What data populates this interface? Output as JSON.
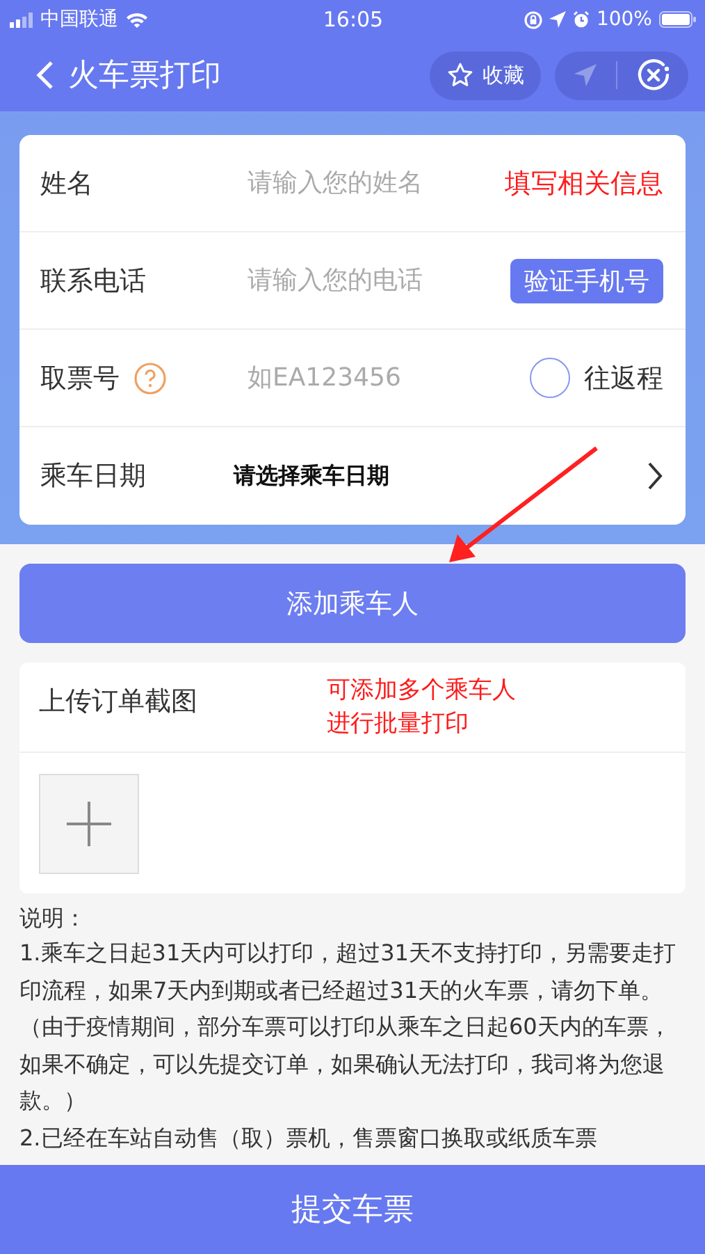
{
  "status_bar": {
    "carrier": "中国联通",
    "time": "16:05",
    "battery": "100%"
  },
  "nav": {
    "title": "火车票打印",
    "favorite": "收藏"
  },
  "form": {
    "fields": [
      {
        "kind": "text",
        "label": "姓名",
        "placeholder": "请输入您的姓名",
        "note": "填写相关信息"
      },
      {
        "kind": "phone",
        "label": "联系电话",
        "placeholder": "请输入您的电话",
        "button": "验证手机号"
      },
      {
        "kind": "ticket",
        "label": "取票号",
        "placeholder": "如EA123456",
        "option": {
          "label": "往返程",
          "checked": false
        }
      },
      {
        "kind": "date",
        "label": "乘车日期",
        "value": "请选择乘车日期"
      }
    ]
  },
  "annotations": [
    {
      "kind": "arrow"
    }
  ],
  "add_button": "添加乘车人",
  "upload": {
    "title": "上传订单截图",
    "note": [
      "可添加多个乘车人",
      "进行批量打印"
    ]
  },
  "notes": {
    "title": "说明：",
    "items": [
      "1.乘车之日起31天内可以打印，超过31天不支持打印，另需要走打印流程，如果7天内到期或者已经超过31天的火车票，请勿下单。（由于疫情期间，部分车票可以打印从乘车之日起60天内的车票，如果不确定，可以先提交订单，如果确认无法打印，我司将为您退款。）",
      "2.已经在车站自动售（取）票机，售票窗口换取或纸质车票"
    ]
  },
  "submit": "提交车票"
}
